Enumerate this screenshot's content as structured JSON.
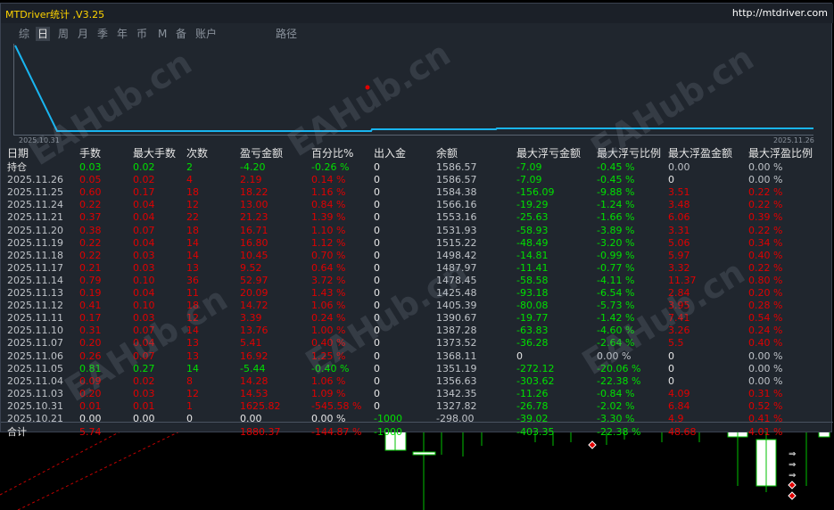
{
  "window": {
    "title": "MTDriver统计 ,V3.25",
    "url": "http://mtdriver.com"
  },
  "tabs": [
    {
      "label": "综",
      "active": false
    },
    {
      "label": "日",
      "active": true
    },
    {
      "label": "周",
      "active": false
    },
    {
      "label": "月",
      "active": false
    },
    {
      "label": "季",
      "active": false
    },
    {
      "label": "年",
      "active": false
    },
    {
      "label": "币",
      "active": false
    },
    {
      "label": "M",
      "active": false
    },
    {
      "label": "备",
      "active": false
    },
    {
      "label": "账户",
      "active": false
    },
    {
      "label": "路径",
      "active": false
    }
  ],
  "curve": {
    "start_label": "2025.10.31",
    "end_label": "2025.11.26",
    "line_color": "#19b5f0",
    "marker_color": "#e00000"
  },
  "watermark": "EAHub.cn",
  "columns": [
    "日期",
    "手数",
    "最大手数",
    "次数",
    "盈亏金额",
    "百分比%",
    "出入金",
    "余额",
    "最大浮亏金额",
    "最大浮亏比例",
    "最大浮盈金额",
    "最大浮盈比例"
  ],
  "rows": [
    {
      "date": "持仓",
      "lots": "0.03",
      "max_lots": "0.02",
      "count": "2",
      "pnl": "-4.20",
      "pct": "-0.26 %",
      "io": "0",
      "balance": "1586.57",
      "max_float_loss": "-7.09",
      "max_float_loss_pct": "-0.45 %",
      "max_float_profit": "0.00",
      "max_float_profit_pct": "0.00 %",
      "c": [
        "neu",
        "pos",
        "pos",
        "pos",
        "pos",
        "pos",
        "neu",
        "grey",
        "pos",
        "pos",
        "grey",
        "grey"
      ]
    },
    {
      "date": "2025.11.26",
      "lots": "0.05",
      "max_lots": "0.02",
      "count": "4",
      "pnl": "2.19",
      "pct": "0.14 %",
      "io": "0",
      "balance": "1586.57",
      "max_float_loss": "-7.09",
      "max_float_loss_pct": "-0.45 %",
      "max_float_profit": "0",
      "max_float_profit_pct": "0.00 %",
      "c": [
        "grey",
        "neg",
        "neg",
        "neg",
        "neg",
        "neg",
        "neu",
        "grey",
        "pos",
        "pos",
        "neu",
        "grey"
      ]
    },
    {
      "date": "2025.11.25",
      "lots": "0.60",
      "max_lots": "0.17",
      "count": "18",
      "pnl": "18.22",
      "pct": "1.16 %",
      "io": "0",
      "balance": "1584.38",
      "max_float_loss": "-156.09",
      "max_float_loss_pct": "-9.88 %",
      "max_float_profit": "3.51",
      "max_float_profit_pct": "0.22 %",
      "c": [
        "grey",
        "neg",
        "neg",
        "neg",
        "neg",
        "neg",
        "neu",
        "grey",
        "pos",
        "pos",
        "neg",
        "neg"
      ]
    },
    {
      "date": "2025.11.24",
      "lots": "0.22",
      "max_lots": "0.04",
      "count": "12",
      "pnl": "13.00",
      "pct": "0.84 %",
      "io": "0",
      "balance": "1566.16",
      "max_float_loss": "-19.29",
      "max_float_loss_pct": "-1.24 %",
      "max_float_profit": "3.48",
      "max_float_profit_pct": "0.22 %",
      "c": [
        "grey",
        "neg",
        "neg",
        "neg",
        "neg",
        "neg",
        "neu",
        "grey",
        "pos",
        "pos",
        "neg",
        "neg"
      ]
    },
    {
      "date": "2025.11.21",
      "lots": "0.37",
      "max_lots": "0.04",
      "count": "22",
      "pnl": "21.23",
      "pct": "1.39 %",
      "io": "0",
      "balance": "1553.16",
      "max_float_loss": "-25.63",
      "max_float_loss_pct": "-1.66 %",
      "max_float_profit": "6.06",
      "max_float_profit_pct": "0.39 %",
      "c": [
        "grey",
        "neg",
        "neg",
        "neg",
        "neg",
        "neg",
        "neu",
        "grey",
        "pos",
        "pos",
        "neg",
        "neg"
      ]
    },
    {
      "date": "2025.11.20",
      "lots": "0.38",
      "max_lots": "0.07",
      "count": "18",
      "pnl": "16.71",
      "pct": "1.10 %",
      "io": "0",
      "balance": "1531.93",
      "max_float_loss": "-58.93",
      "max_float_loss_pct": "-3.89 %",
      "max_float_profit": "3.31",
      "max_float_profit_pct": "0.22 %",
      "c": [
        "grey",
        "neg",
        "neg",
        "neg",
        "neg",
        "neg",
        "neu",
        "grey",
        "pos",
        "pos",
        "neg",
        "neg"
      ]
    },
    {
      "date": "2025.11.19",
      "lots": "0.22",
      "max_lots": "0.04",
      "count": "14",
      "pnl": "16.80",
      "pct": "1.12 %",
      "io": "0",
      "balance": "1515.22",
      "max_float_loss": "-48.49",
      "max_float_loss_pct": "-3.20 %",
      "max_float_profit": "5.06",
      "max_float_profit_pct": "0.34 %",
      "c": [
        "grey",
        "neg",
        "neg",
        "neg",
        "neg",
        "neg",
        "neu",
        "grey",
        "pos",
        "pos",
        "neg",
        "neg"
      ]
    },
    {
      "date": "2025.11.18",
      "lots": "0.22",
      "max_lots": "0.03",
      "count": "14",
      "pnl": "10.45",
      "pct": "0.70 %",
      "io": "0",
      "balance": "1498.42",
      "max_float_loss": "-14.81",
      "max_float_loss_pct": "-0.99 %",
      "max_float_profit": "5.97",
      "max_float_profit_pct": "0.40 %",
      "c": [
        "grey",
        "neg",
        "neg",
        "neg",
        "neg",
        "neg",
        "neu",
        "grey",
        "pos",
        "pos",
        "neg",
        "neg"
      ]
    },
    {
      "date": "2025.11.17",
      "lots": "0.21",
      "max_lots": "0.03",
      "count": "13",
      "pnl": "9.52",
      "pct": "0.64 %",
      "io": "0",
      "balance": "1487.97",
      "max_float_loss": "-11.41",
      "max_float_loss_pct": "-0.77 %",
      "max_float_profit": "3.32",
      "max_float_profit_pct": "0.22 %",
      "c": [
        "grey",
        "neg",
        "neg",
        "neg",
        "neg",
        "neg",
        "neu",
        "grey",
        "pos",
        "pos",
        "neg",
        "neg"
      ]
    },
    {
      "date": "2025.11.14",
      "lots": "0.79",
      "max_lots": "0.10",
      "count": "36",
      "pnl": "52.97",
      "pct": "3.72 %",
      "io": "0",
      "balance": "1478.45",
      "max_float_loss": "-58.58",
      "max_float_loss_pct": "-4.11 %",
      "max_float_profit": "11.37",
      "max_float_profit_pct": "0.80 %",
      "c": [
        "grey",
        "neg",
        "neg",
        "neg",
        "neg",
        "neg",
        "neu",
        "grey",
        "pos",
        "pos",
        "neg",
        "neg"
      ]
    },
    {
      "date": "2025.11.13",
      "lots": "0.19",
      "max_lots": "0.04",
      "count": "11",
      "pnl": "20.09",
      "pct": "1.43 %",
      "io": "0",
      "balance": "1425.48",
      "max_float_loss": "-93.18",
      "max_float_loss_pct": "-6.54 %",
      "max_float_profit": "2.84",
      "max_float_profit_pct": "0.20 %",
      "c": [
        "grey",
        "neg",
        "neg",
        "neg",
        "neg",
        "neg",
        "neu",
        "grey",
        "pos",
        "pos",
        "neg",
        "neg"
      ]
    },
    {
      "date": "2025.11.12",
      "lots": "0.41",
      "max_lots": "0.10",
      "count": "18",
      "pnl": "14.72",
      "pct": "1.06 %",
      "io": "0",
      "balance": "1405.39",
      "max_float_loss": "-80.08",
      "max_float_loss_pct": "-5.73 %",
      "max_float_profit": "3.95",
      "max_float_profit_pct": "0.28 %",
      "c": [
        "grey",
        "neg",
        "neg",
        "neg",
        "neg",
        "neg",
        "neu",
        "grey",
        "pos",
        "pos",
        "neg",
        "neg"
      ]
    },
    {
      "date": "2025.11.11",
      "lots": "0.17",
      "max_lots": "0.03",
      "count": "12",
      "pnl": "3.39",
      "pct": "0.24 %",
      "io": "0",
      "balance": "1390.67",
      "max_float_loss": "-19.77",
      "max_float_loss_pct": "-1.42 %",
      "max_float_profit": "7.41",
      "max_float_profit_pct": "0.54 %",
      "c": [
        "grey",
        "neg",
        "neg",
        "neg",
        "neg",
        "neg",
        "neu",
        "grey",
        "pos",
        "pos",
        "neg",
        "neg"
      ]
    },
    {
      "date": "2025.11.10",
      "lots": "0.31",
      "max_lots": "0.07",
      "count": "14",
      "pnl": "13.76",
      "pct": "1.00 %",
      "io": "0",
      "balance": "1387.28",
      "max_float_loss": "-63.83",
      "max_float_loss_pct": "-4.60 %",
      "max_float_profit": "3.26",
      "max_float_profit_pct": "0.24 %",
      "c": [
        "grey",
        "neg",
        "neg",
        "neg",
        "neg",
        "neg",
        "neu",
        "grey",
        "pos",
        "pos",
        "neg",
        "neg"
      ]
    },
    {
      "date": "2025.11.07",
      "lots": "0.20",
      "max_lots": "0.04",
      "count": "13",
      "pnl": "5.41",
      "pct": "0.40 %",
      "io": "0",
      "balance": "1373.52",
      "max_float_loss": "-36.28",
      "max_float_loss_pct": "-2.64 %",
      "max_float_profit": "5.5",
      "max_float_profit_pct": "0.40 %",
      "c": [
        "grey",
        "neg",
        "neg",
        "neg",
        "neg",
        "neg",
        "neu",
        "grey",
        "pos",
        "pos",
        "neg",
        "neg"
      ]
    },
    {
      "date": "2025.11.06",
      "lots": "0.26",
      "max_lots": "0.07",
      "count": "13",
      "pnl": "16.92",
      "pct": "1.25 %",
      "io": "0",
      "balance": "1368.11",
      "max_float_loss": "0",
      "max_float_loss_pct": "0.00 %",
      "max_float_profit": "0",
      "max_float_profit_pct": "0.00 %",
      "c": [
        "grey",
        "neg",
        "neg",
        "neg",
        "neg",
        "neg",
        "neu",
        "grey",
        "neu",
        "grey",
        "neu",
        "grey"
      ]
    },
    {
      "date": "2025.11.05",
      "lots": "0.81",
      "max_lots": "0.27",
      "count": "14",
      "pnl": "-5.44",
      "pct": "-0.40 %",
      "io": "0",
      "balance": "1351.19",
      "max_float_loss": "-272.12",
      "max_float_loss_pct": "-20.06 %",
      "max_float_profit": "0",
      "max_float_profit_pct": "0.00 %",
      "c": [
        "grey",
        "pos",
        "pos",
        "pos",
        "pos",
        "pos",
        "neu",
        "grey",
        "pos",
        "pos",
        "neu",
        "grey"
      ]
    },
    {
      "date": "2025.11.04",
      "lots": "0.09",
      "max_lots": "0.02",
      "count": "8",
      "pnl": "14.28",
      "pct": "1.06 %",
      "io": "0",
      "balance": "1356.63",
      "max_float_loss": "-303.62",
      "max_float_loss_pct": "-22.38 %",
      "max_float_profit": "0",
      "max_float_profit_pct": "0.00 %",
      "c": [
        "grey",
        "neg",
        "neg",
        "neg",
        "neg",
        "neg",
        "neu",
        "grey",
        "pos",
        "pos",
        "neu",
        "grey"
      ]
    },
    {
      "date": "2025.11.03",
      "lots": "0.20",
      "max_lots": "0.03",
      "count": "12",
      "pnl": "14.53",
      "pct": "1.09 %",
      "io": "0",
      "balance": "1342.35",
      "max_float_loss": "-11.26",
      "max_float_loss_pct": "-0.84 %",
      "max_float_profit": "4.09",
      "max_float_profit_pct": "0.31 %",
      "c": [
        "grey",
        "neg",
        "neg",
        "neg",
        "neg",
        "neg",
        "neu",
        "grey",
        "pos",
        "pos",
        "neg",
        "neg"
      ]
    },
    {
      "date": "2025.10.31",
      "lots": "0.01",
      "max_lots": "0.01",
      "count": "1",
      "pnl": "1625.82",
      "pct": "-545.58 %",
      "io": "0",
      "balance": "1327.82",
      "max_float_loss": "-26.78",
      "max_float_loss_pct": "-2.02 %",
      "max_float_profit": "6.84",
      "max_float_profit_pct": "0.52 %",
      "c": [
        "grey",
        "neg",
        "neg",
        "neg",
        "neg",
        "neg",
        "neu",
        "grey",
        "pos",
        "pos",
        "neg",
        "neg"
      ]
    },
    {
      "date": "2025.10.21",
      "lots": "0.00",
      "max_lots": "0.00",
      "count": "0",
      "pnl": "0.00",
      "pct": "0.00 %",
      "io": "-1000",
      "balance": "-298.00",
      "max_float_loss": "-39.02",
      "max_float_loss_pct": "-3.30 %",
      "max_float_profit": "4.9",
      "max_float_profit_pct": "0.41 %",
      "c": [
        "grey",
        "neu",
        "neu",
        "neu",
        "neu",
        "neu",
        "pos",
        "grey",
        "pos",
        "pos",
        "neg",
        "neg"
      ]
    }
  ],
  "total": {
    "label": "合计",
    "lots": "5.74",
    "pnl": "1880.37",
    "pct": "-144.87 %",
    "io": "-1000",
    "max_float_loss": "-403.35",
    "max_float_loss_pct": "-22.38 %",
    "max_float_profit": "48.68",
    "max_float_profit_pct": "4.01 %"
  }
}
